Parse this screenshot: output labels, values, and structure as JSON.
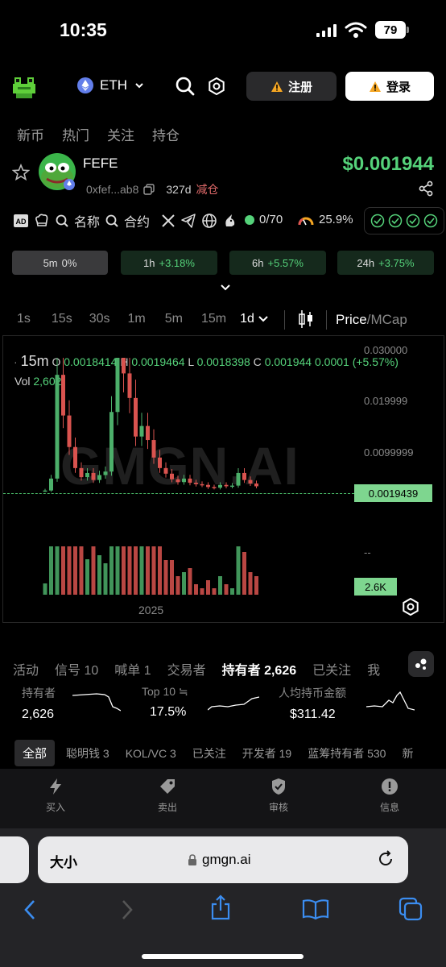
{
  "status_bar": {
    "time": "10:35",
    "battery": "79"
  },
  "header": {
    "chain": "ETH",
    "register_label": "注册",
    "login_label": "登录"
  },
  "top_tabs": [
    "新币",
    "热门",
    "关注",
    "持仓"
  ],
  "token": {
    "name": "FEFE",
    "address": "0xfef...ab8",
    "age": "327d",
    "age_tag": "减仓",
    "price": "$0.001944"
  },
  "badges": {
    "name_label": "名称",
    "contract_label": "合约",
    "score": "0/70",
    "percent": "25.9%"
  },
  "timeframe_stats": [
    {
      "label": "5m",
      "value": "0%"
    },
    {
      "label": "1h",
      "value": "+3.18%"
    },
    {
      "label": "6h",
      "value": "+5.57%"
    },
    {
      "label": "24h",
      "value": "+3.75%"
    }
  ],
  "intervals": [
    "1s",
    "15s",
    "30s",
    "1m",
    "5m",
    "15m",
    "1d"
  ],
  "price_toggle": {
    "price": "Price",
    "sep": "/",
    "mcap": "MCap"
  },
  "chart": {
    "interval": "15m",
    "o_label": "O",
    "o": "0.0018414",
    "h_label": "H",
    "h": "0.0019464",
    "l_label": "L",
    "l": "0.0018398",
    "c_label": "C",
    "c": "0.001944",
    "change": "0.0001 (+5.57%)",
    "vol_label": "Vol",
    "vol": "2,602",
    "watermark": "GMGN.AI",
    "y_ticks": [
      "0.030000",
      "0.019999",
      "0.0099999"
    ],
    "current_price": "0.0019439",
    "vol_axis": "--",
    "vol_tag": "2.6K",
    "x_label": "2025"
  },
  "chart_data": {
    "type": "candlestick",
    "x_label": "2025",
    "y_ticks": [
      0.03,
      0.019999,
      0.0099999
    ],
    "last_price": 0.0019439,
    "close_series": [
      0.0013,
      0.003,
      0.0178,
      0.012,
      0.0075,
      0.0045,
      0.0032,
      0.0038,
      0.0028,
      0.0035,
      0.004,
      0.0125,
      0.024,
      0.018,
      0.0145,
      0.009,
      0.0105,
      0.0085,
      0.006,
      0.0045,
      0.0037,
      0.0029,
      0.0025,
      0.003,
      0.0024,
      0.0022,
      0.0021,
      0.0018,
      0.0017,
      0.0021,
      0.0019,
      0.002,
      0.0038,
      0.0028,
      0.0023,
      0.0019
    ]
  },
  "section_tabs": [
    "活动",
    "信号 10",
    "喊单 1",
    "交易者",
    "持有者 2,626",
    "已关注",
    "我"
  ],
  "stats": [
    {
      "label": "持有者",
      "value": "2,626"
    },
    {
      "label": "Top 10 ≒",
      "value": "17.5%"
    },
    {
      "label": "人均持币金额",
      "value": "$311.42"
    }
  ],
  "holder_tabs": [
    "全部",
    "聪明钱 3",
    "KOL/VC 3",
    "已关注",
    "开发者 19",
    "蓝筹持有者 530",
    "新"
  ],
  "bottom_nav": [
    "买入",
    "卖出",
    "审核",
    "信息"
  ],
  "safari": {
    "text_size": "大小",
    "url": "gmgn.ai"
  },
  "colors": {
    "accent_green": "#55d27a",
    "up": "#4caf6a",
    "down": "#d9534f",
    "warning": "#f5a623"
  }
}
